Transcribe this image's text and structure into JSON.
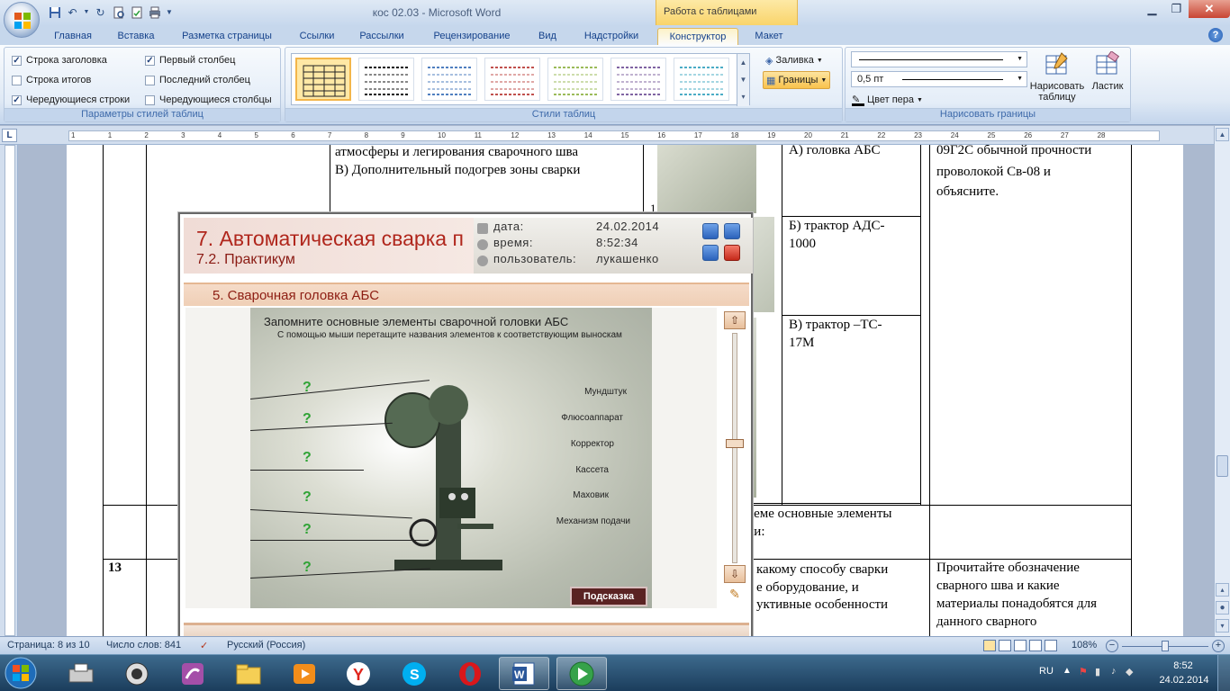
{
  "window": {
    "doc_title": "кос 02.03 - Microsoft Word",
    "context_tab_header": "Работа с таблицами"
  },
  "tabs": [
    {
      "label": "Главная"
    },
    {
      "label": "Вставка"
    },
    {
      "label": "Разметка страницы"
    },
    {
      "label": "Ссылки"
    },
    {
      "label": "Рассылки"
    },
    {
      "label": "Рецензирование"
    },
    {
      "label": "Вид"
    },
    {
      "label": "Надстройки"
    },
    {
      "label": "Конструктор"
    },
    {
      "label": "Макет"
    }
  ],
  "ribbon": {
    "table_style_options": {
      "label": "Параметры стилей таблиц",
      "options": [
        {
          "label": "Строка заголовка",
          "checked": true
        },
        {
          "label": "Строка итогов",
          "checked": false
        },
        {
          "label": "Чередующиеся строки",
          "checked": true
        },
        {
          "label": "Первый столбец",
          "checked": true
        },
        {
          "label": "Последний столбец",
          "checked": false
        },
        {
          "label": "Чередующиеся столбцы",
          "checked": false
        }
      ]
    },
    "table_styles": {
      "label": "Стили таблиц",
      "shading_label": "Заливка",
      "borders_label": "Границы"
    },
    "draw_borders": {
      "label": "Нарисовать границы",
      "pen_weight": "0,5 пт",
      "pen_color_label": "Цвет пера",
      "draw_table_label": "Нарисовать таблицу",
      "eraser_label": "Ластик"
    }
  },
  "ruler_numbers": [
    "1",
    "1",
    "2",
    "3",
    "4",
    "5",
    "6",
    "7",
    "8",
    "9",
    "10",
    "11",
    "12",
    "13",
    "14",
    "15",
    "16",
    "17",
    "18",
    "19",
    "20",
    "21",
    "22",
    "23",
    "24",
    "25",
    "26",
    "27",
    "28"
  ],
  "document": {
    "col3_top_lines": [
      "атмосферы и легирования сварочного шва",
      "В)  Дополнительный подогрев зоны сварки"
    ],
    "row_number_left": "1",
    "cell_a": "А) головка АБС",
    "cell_b": [
      "Б) трактор АДС-",
      "1000"
    ],
    "cell_v": [
      "В) трактор –ТС-",
      "17М"
    ],
    "col_right_top": [
      "09Г2С обычной  прочности",
      "проволокой  Св-08 и",
      "объясните."
    ],
    "mid_text": [
      "хеме основные элементы",
      "ки:"
    ],
    "row13_num": "13",
    "row13_text": [
      "какому способу сварки",
      "е оборудование, и",
      "уктивные  особенности"
    ],
    "row13_right": [
      "Прочитайте обозначение",
      "сварного шва и какие",
      "материалы понадобятся для",
      "данного сварного"
    ]
  },
  "popup": {
    "title": "7. Автоматическая сварка п",
    "subtitle": "7.2. Практикум",
    "date_label": "дата:",
    "date_value": "24.02.2014",
    "time_label": "время:",
    "time_value": "8:52:34",
    "user_label": "пользователь:",
    "user_value": "лукашенко",
    "section": "5. Сварочная головка АБС",
    "exercise_title": "Запомните основные элементы сварочной головки АБС",
    "exercise_sub": "С помощью мыши перетащите названия элементов к соответствующим выноскам",
    "placeholder_mark": "?",
    "elements": [
      "Мундштук",
      "Флюсоаппарат",
      "Корректор",
      "Кассета",
      "Маховик",
      "Механизм подачи"
    ],
    "hint_button": "Подсказка"
  },
  "statusbar": {
    "page": "Страница: 8 из 10",
    "words": "Число слов: 841",
    "language": "Русский (Россия)",
    "zoom": "108%"
  },
  "tray": {
    "lang": "RU",
    "time": "8:52",
    "date": "24.02.2014"
  },
  "colors": {
    "ribbon_bg": "#dfe9f5",
    "context_tab": "#f9d46b",
    "popup_title": "#b0261c",
    "qmark_green": "#2fa335",
    "taskbar": "#1b3d5c"
  }
}
